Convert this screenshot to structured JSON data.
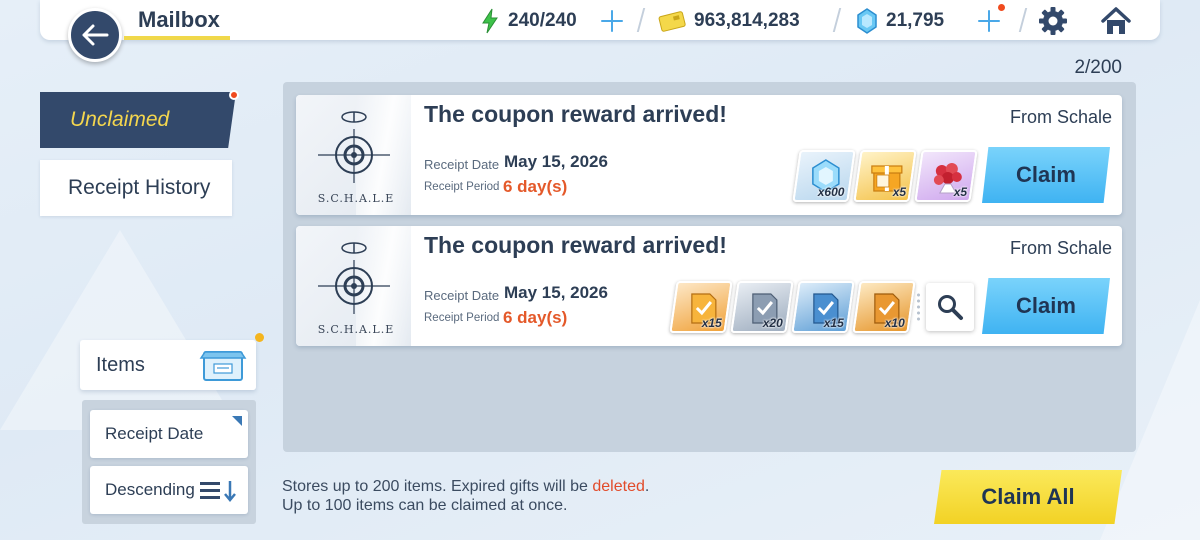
{
  "header": {
    "title": "Mailbox",
    "stamina": "240/240",
    "credits": "963,814,283",
    "gems": "21,795",
    "icons": [
      "back-arrow-icon",
      "stamina-bolt-icon",
      "credit-card-icon",
      "pyroxene-gem-icon",
      "settings-gear-icon",
      "home-icon"
    ]
  },
  "tabs": {
    "unclaimed": "Unclaimed",
    "history": "Receipt History"
  },
  "filter": {
    "items_label": "Items",
    "sort_field": "Receipt Date",
    "sort_order": "Descending"
  },
  "mailbox": {
    "count": "2/200",
    "mails": [
      {
        "title": "The coupon reward arrived!",
        "from": "From Schale",
        "logo_text": "S.C.H.A.L.E",
        "date_label": "Receipt Date",
        "date": "May 15, 2026",
        "period_label": "Receipt Period",
        "period": "6 day(s)",
        "rewards": [
          {
            "icon": "pyroxene-crystal-icon",
            "qty": "x600"
          },
          {
            "icon": "gift-box-icon",
            "qty": "x5"
          },
          {
            "icon": "flower-bouquet-icon",
            "qty": "x5"
          }
        ],
        "claim": "Claim"
      },
      {
        "title": "The coupon reward arrived!",
        "from": "From Schale",
        "logo_text": "S.C.H.A.L.E",
        "date_label": "Receipt Date",
        "date": "May 15, 2026",
        "period_label": "Receipt Period",
        "period": "6 day(s)",
        "rewards": [
          {
            "icon": "activity-report-orange-icon",
            "qty": "x15"
          },
          {
            "icon": "activity-report-grey-icon",
            "qty": "x20"
          },
          {
            "icon": "activity-report-blue-icon",
            "qty": "x15"
          },
          {
            "icon": "activity-report-gold-icon",
            "qty": "x10"
          }
        ],
        "claim": "Claim"
      }
    ]
  },
  "footer": {
    "note_line1_pre": "Stores up to 200 items. Expired gifts will be ",
    "note_line1_deleted": "deleted",
    "note_line1_post": ".",
    "note_line2": "Up to 100 items can be claimed at once.",
    "claim_all": "Claim All"
  },
  "colors": {
    "navy": "#33496b",
    "accent_yellow": "#f4d64e",
    "claim_blue": "#4ab8f4",
    "period_orange": "#e4592a",
    "claim_all_yellow": "#f5da2e"
  }
}
